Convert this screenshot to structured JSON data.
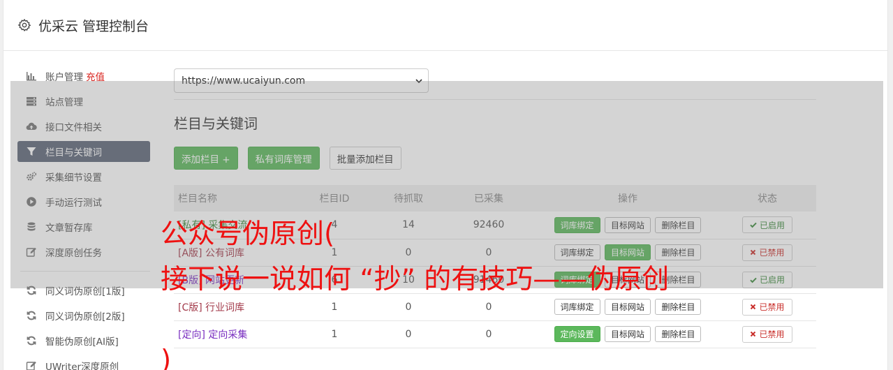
{
  "header": {
    "title": "优采云 管理控制台"
  },
  "sidebar": {
    "items": [
      {
        "label": "账户管理",
        "extra": "充值",
        "icon": "bar-chart-icon"
      },
      {
        "label": "站点管理",
        "icon": "server-icon"
      },
      {
        "label": "接口文件相关",
        "icon": "cloud-upload-icon"
      },
      {
        "label": "栏目与关键词",
        "icon": "filter-icon",
        "active": true
      },
      {
        "label": "采集细节设置",
        "icon": "cogs-icon"
      },
      {
        "label": "手动运行测试",
        "icon": "play-circle-icon"
      },
      {
        "label": "文章暂存库",
        "icon": "database-icon"
      },
      {
        "label": "深度原创任务",
        "icon": "edit-icon"
      },
      {
        "label": "同义词伪原创[1版]",
        "icon": "refresh-icon"
      },
      {
        "label": "同义词伪原创[2版]",
        "icon": "refresh-icon"
      },
      {
        "label": "智能伪原创[AI版]",
        "icon": "refresh-icon"
      },
      {
        "label": "UWriter深度原创",
        "icon": "edit-icon"
      }
    ]
  },
  "main": {
    "site_select": {
      "value": "https://www.ucaiyun.com"
    },
    "section_title": "栏目与关键词",
    "buttons": {
      "add_column": "添加栏目 +",
      "private_lexicon": "私有词库管理",
      "batch_add": "批量添加栏目"
    },
    "table": {
      "headers": [
        "栏目名称",
        "栏目ID",
        "待抓取",
        "已采集",
        "操作",
        "状态"
      ],
      "rows": [
        {
          "tag": "[私有]",
          "name": "采集交流",
          "id": "4",
          "pending": "14",
          "collected": "92460",
          "actions": [
            "词库绑定",
            "目标网站",
            "删除栏目"
          ],
          "status": "已启用"
        },
        {
          "tag": "[A版]",
          "name": "公有词库",
          "id": "1",
          "pending": "0",
          "collected": "0",
          "actions": [
            "词库绑定",
            "目标网站",
            "删除栏目"
          ],
          "status": "已禁用"
        },
        {
          "tag": "[B版]",
          "name": "网站更新",
          "id": "6",
          "pending": "10",
          "collected": "91460",
          "actions": [
            "词库绑定",
            "目标网站",
            "删除栏目"
          ],
          "status": "已启用"
        },
        {
          "tag": "[C版]",
          "name": "行业词库",
          "id": "1",
          "pending": "0",
          "collected": "0",
          "actions": [
            "词库绑定",
            "目标网站",
            "删除栏目"
          ],
          "status": "已禁用"
        },
        {
          "tag": "[定向]",
          "name": "定向采集",
          "id": "1",
          "pending": "0",
          "collected": "0",
          "actions": [
            "定向设置",
            "目标网站",
            "删除栏目"
          ],
          "status": "已禁用"
        }
      ]
    }
  },
  "watermark": {
    "line1": "公众号伪原创(",
    "line2": "接下说一说如何 “抄” 的有技巧——伪原创",
    "line3": ")"
  },
  "colors": {
    "accent_green": "#5cb85c",
    "active_nav": "#5d6678",
    "watermark_red": "#ee1111",
    "recharge_red": "#d9221c"
  }
}
